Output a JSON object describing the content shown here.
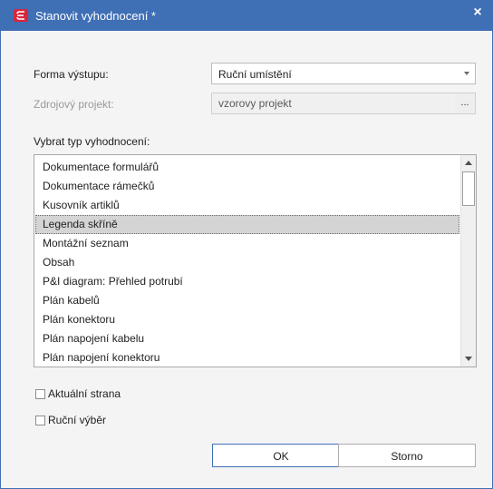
{
  "window": {
    "title": "Stanovit vyhodnocení *",
    "close_label": "×",
    "accent_color": "#3f6fb5",
    "app_icon_color": "#d7263d"
  },
  "form": {
    "output_label": "Forma výstupu:",
    "output_value": "Ruční umístění",
    "source_label": "Zdrojový projekt:",
    "source_value": "vzorovy projekt",
    "browse_label": "..."
  },
  "list": {
    "label": "Vybrat typ vyhodnocení:",
    "items": [
      "Dokumentace formulářů",
      "Dokumentace rámečků",
      "Kusovník artiklů",
      "Legenda skříně",
      "Montážní seznam",
      "Obsah",
      "P&I diagram: Přehled potrubí",
      "Plán kabelů",
      "Plán konektoru",
      "Plán napojení kabelu",
      "Plán napojení konektoru"
    ],
    "selected_index": 3
  },
  "options": {
    "current_page_label": "Aktuální strana",
    "manual_selection_label": "Ruční výběr",
    "current_page_checked": false,
    "manual_selection_checked": false
  },
  "buttons": {
    "ok_label": "OK",
    "cancel_label": "Storno"
  }
}
